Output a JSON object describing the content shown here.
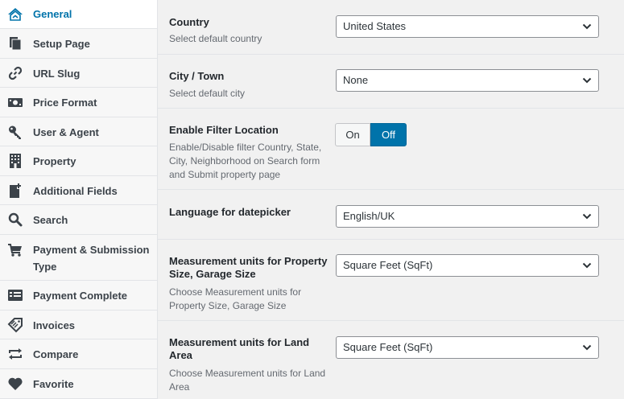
{
  "sidebar": {
    "items": [
      {
        "label": "General",
        "icon": "home-icon"
      },
      {
        "label": "Setup Page",
        "icon": "page-icon"
      },
      {
        "label": "URL Slug",
        "icon": "link-icon"
      },
      {
        "label": "Price Format",
        "icon": "money-icon"
      },
      {
        "label": "User & Agent",
        "icon": "key-icon"
      },
      {
        "label": "Property",
        "icon": "building-icon"
      },
      {
        "label": "Additional Fields",
        "icon": "add-page-icon"
      },
      {
        "label": "Search",
        "icon": "search-icon"
      },
      {
        "label": "Payment & Submission Type",
        "icon": "cart-icon"
      },
      {
        "label": "Payment Complete",
        "icon": "list-icon"
      },
      {
        "label": "Invoices",
        "icon": "tag-icon"
      },
      {
        "label": "Compare",
        "icon": "compare-icon"
      },
      {
        "label": "Favorite",
        "icon": "heart-icon"
      }
    ]
  },
  "settings": {
    "country": {
      "title": "Country",
      "desc": "Select default country",
      "value": "United States"
    },
    "city": {
      "title": "City / Town",
      "desc": "Select default city",
      "value": "None"
    },
    "filter": {
      "title": "Enable Filter Location",
      "desc": "Enable/Disable filter Country, State, City, Neighborhood on Search form and Submit property page",
      "on_label": "On",
      "off_label": "Off"
    },
    "language": {
      "title": "Language for datepicker",
      "value": "English/UK"
    },
    "measure_property": {
      "title": "Measurement units for Property Size, Garage Size",
      "desc": "Choose Measurement units for Property Size, Garage Size",
      "value": "Square Feet (SqFt)"
    },
    "measure_land": {
      "title": "Measurement units for Land Area",
      "desc": "Choose Measurement units for Land Area",
      "value": "Square Feet (SqFt)"
    }
  },
  "colors": {
    "accent": "#0073aa",
    "background": "#f1f1f1"
  }
}
